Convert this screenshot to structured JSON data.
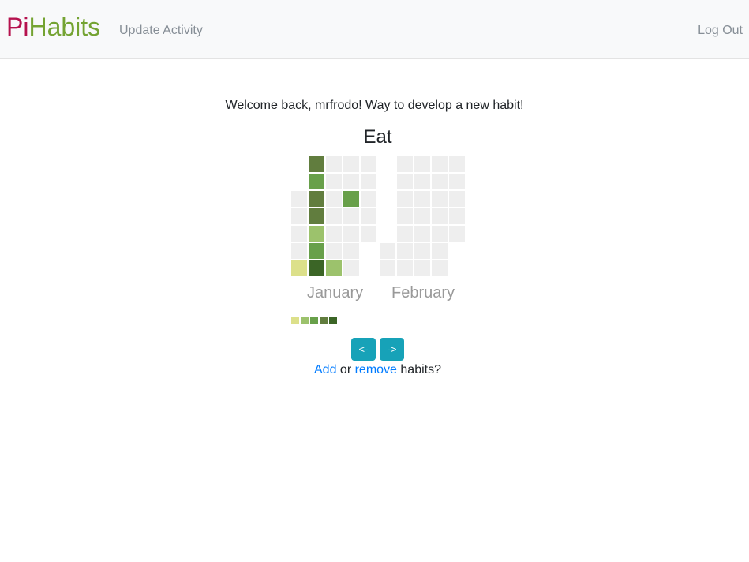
{
  "navbar": {
    "brand_pi": "Pi",
    "brand_habits": "Habits",
    "update_activity": "Update Activity",
    "log_out": "Log Out"
  },
  "main": {
    "welcome": "Welcome back, mrfrodo! Way to develop a new habit!",
    "habit_name": "Eat"
  },
  "calendar": {
    "months": [
      {
        "label": "January",
        "weeks": [
          [
            null,
            null,
            0,
            0,
            0,
            0,
            1
          ],
          [
            4,
            3,
            4,
            4,
            2,
            3,
            5
          ],
          [
            0,
            0,
            0,
            0,
            0,
            0,
            2
          ],
          [
            0,
            0,
            3,
            0,
            0,
            0,
            0
          ],
          [
            0,
            0,
            0,
            0,
            0,
            null,
            null
          ]
        ]
      },
      {
        "label": "February",
        "weeks": [
          [
            null,
            null,
            null,
            null,
            null,
            0,
            0
          ],
          [
            0,
            0,
            0,
            0,
            0,
            0,
            0
          ],
          [
            0,
            0,
            0,
            0,
            0,
            0,
            0
          ],
          [
            0,
            0,
            0,
            0,
            0,
            0,
            0
          ],
          [
            0,
            0,
            0,
            0,
            0,
            null,
            null
          ]
        ]
      }
    ],
    "colors": [
      "#eeeeee",
      "#d6e685",
      "#8cc665",
      "#44a340",
      "#1e6823"
    ],
    "display_colors": [
      "#eeeeee",
      "#dce08a",
      "#9cc26c",
      "#68a04a",
      "#617d3e",
      "#3b6526"
    ],
    "legend_colors": [
      "#dce08a",
      "#9cc26c",
      "#68a04a",
      "#617d3e",
      "#3b6526"
    ]
  },
  "controls": {
    "prev_label": "<-",
    "next_label": "->"
  },
  "footer": {
    "add_label": "Add",
    "or_text": " or ",
    "remove_label": "remove",
    "suffix_text": " habits?"
  }
}
